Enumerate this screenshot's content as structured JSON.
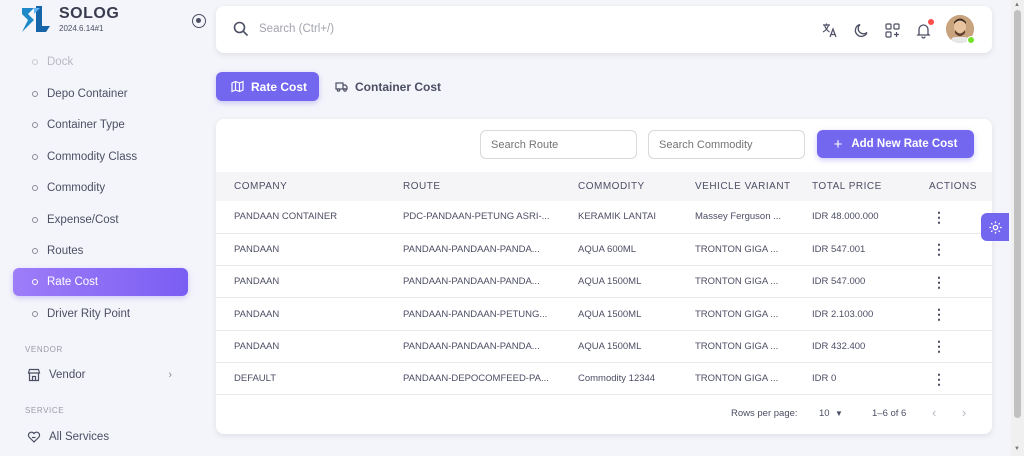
{
  "brand": {
    "name": "SOLOG",
    "version": "2024.6.14#1"
  },
  "sidebar": {
    "items": [
      {
        "label": "Dock"
      },
      {
        "label": "Depo Container"
      },
      {
        "label": "Container Type"
      },
      {
        "label": "Commodity Class"
      },
      {
        "label": "Commodity"
      },
      {
        "label": "Expense/Cost"
      },
      {
        "label": "Routes"
      },
      {
        "label": "Rate Cost"
      },
      {
        "label": "Driver Rity Point"
      }
    ],
    "vendor_section": "VENDOR",
    "vendor_label": "Vendor",
    "service_section": "SERVICE",
    "service_label": "All Services"
  },
  "topbar": {
    "search_placeholder": "Search (Ctrl+/)"
  },
  "tabs": {
    "rate_cost": "Rate Cost",
    "container_cost": "Container Cost"
  },
  "filters": {
    "route_placeholder": "Search Route",
    "commodity_placeholder": "Search Commodity"
  },
  "add_button": "Add New Rate Cost",
  "table": {
    "headers": [
      "COMPANY",
      "ROUTE",
      "COMMODITY",
      "VEHICLE VARIANT",
      "TOTAL PRICE",
      "ACTIONS"
    ],
    "rows": [
      [
        "PANDAAN CONTAINER",
        "PDC-PANDAAN-PETUNG ASRI-...",
        "KERAMIK LANTAI",
        "Massey Ferguson ...",
        "IDR 48.000.000"
      ],
      [
        "PANDAAN",
        "PANDAAN-PANDAAN-PANDA...",
        "AQUA 600ML",
        "TRONTON GIGA ...",
        "IDR 547.001"
      ],
      [
        "PANDAAN",
        "PANDAAN-PANDAAN-PANDA...",
        "AQUA 1500ML",
        "TRONTON GIGA ...",
        "IDR 547.000"
      ],
      [
        "PANDAAN",
        "PANDAAN-PANDAAN-PETUNG...",
        "AQUA 1500ML",
        "TRONTON GIGA ...",
        "IDR 2.103.000"
      ],
      [
        "PANDAAN",
        "PANDAAN-PANDAAN-PANDA...",
        "AQUA 1500ML",
        "TRONTON GIGA ...",
        "IDR 432.400"
      ],
      [
        "DEFAULT",
        "PANDAAN-DEPOCOMFEED-PA...",
        "Commodity 12344",
        "TRONTON GIGA ...",
        "IDR 0"
      ]
    ]
  },
  "pagination": {
    "rows_label": "Rows per page:",
    "rows_value": "10",
    "range": "1–6 of 6"
  },
  "colors": {
    "primary": "#7367f0",
    "text": "#4c4e64",
    "online": "#72e128",
    "notification": "#ff4d49"
  },
  "icons": [
    "search-icon",
    "translate-icon",
    "moon-icon",
    "apps-add-icon",
    "bell-icon",
    "map-icon",
    "truck-icon",
    "plus-icon",
    "gear-icon",
    "store-icon",
    "heart-hand-icon"
  ]
}
